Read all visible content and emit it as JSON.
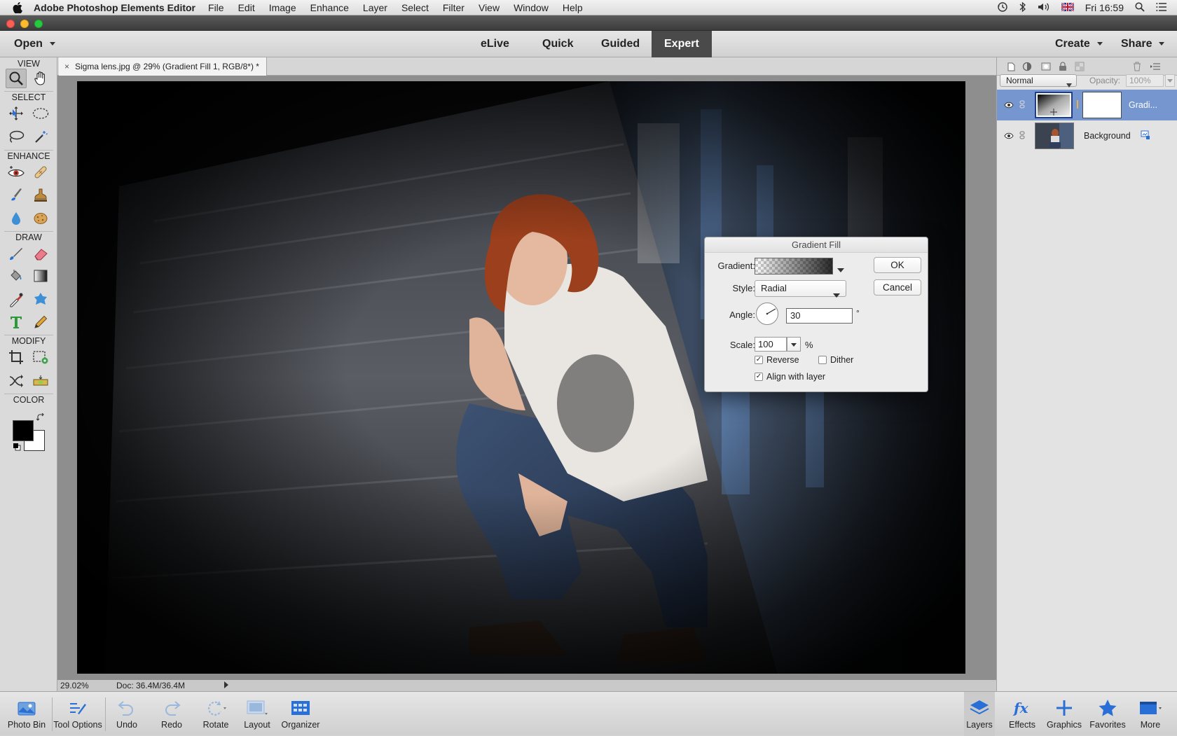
{
  "menubar": {
    "app_name": "Adobe Photoshop Elements Editor",
    "items": [
      "File",
      "Edit",
      "Image",
      "Enhance",
      "Layer",
      "Select",
      "Filter",
      "View",
      "Window",
      "Help"
    ],
    "clock": "Fri 16:59"
  },
  "modebar": {
    "open_label": "Open",
    "tabs": [
      "eLive",
      "Quick",
      "Guided",
      "Expert"
    ],
    "active_tab": "Expert",
    "create_label": "Create",
    "share_label": "Share"
  },
  "toolbox": {
    "sections": [
      "VIEW",
      "SELECT",
      "ENHANCE",
      "DRAW",
      "MODIFY",
      "COLOR"
    ],
    "foreground_color": "#000000",
    "background_color": "#ffffff"
  },
  "document": {
    "tab_title": "Sigma lens.jpg @ 29% (Gradient Fill 1, RGB/8*) *",
    "zoom": "29.02%",
    "doc_size": "Doc: 36.4M/36.4M"
  },
  "layers_panel": {
    "blend_mode": "Normal",
    "opacity_label": "Opacity:",
    "opacity_value": "100%",
    "layers": [
      {
        "name": "Gradi...",
        "selected": true
      },
      {
        "name": "Background",
        "selected": false
      }
    ]
  },
  "dialog": {
    "title": "Gradient Fill",
    "gradient_label": "Gradient:",
    "style_label": "Style:",
    "style_value": "Radial",
    "angle_label": "Angle:",
    "angle_value": "30",
    "degree_symbol": "°",
    "scale_label": "Scale:",
    "scale_value": "100",
    "percent_symbol": "%",
    "reverse_label": "Reverse",
    "reverse_checked": true,
    "dither_label": "Dither",
    "dither_checked": false,
    "align_label": "Align with layer",
    "align_checked": true,
    "ok_label": "OK",
    "cancel_label": "Cancel"
  },
  "bottombar": {
    "left_items": [
      "Photo Bin",
      "Tool Options",
      "Undo",
      "Redo",
      "Rotate",
      "Layout",
      "Organizer"
    ],
    "right_items": [
      "Layers",
      "Effects",
      "Graphics",
      "Favorites",
      "More"
    ],
    "active_right": "Layers"
  },
  "colors": {
    "accent_blue": "#2a6fd6",
    "layer_selected": "#7596cf"
  }
}
